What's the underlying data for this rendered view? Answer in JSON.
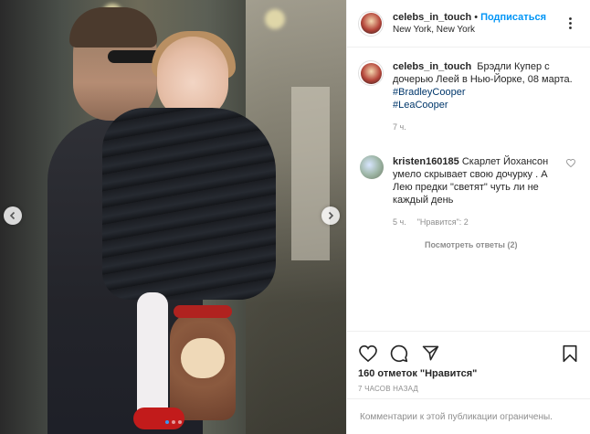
{
  "post": {
    "username": "celebs_in_touch",
    "separator": "•",
    "follow_label": "Подписаться",
    "location": "New York, New York"
  },
  "caption": {
    "username": "celebs_in_touch",
    "text": "Брэдли Купер с дочерью Леей в Нью-Йорке, 08 марта.",
    "hashtags": [
      "#BradleyCooper",
      "#LeaCooper"
    ],
    "time": "7 ч."
  },
  "comment": {
    "username": "kristen160185",
    "text": "Скарлет Йохансон умело скрывает свою дочурку . А Лею предки \"светят\" чуть ли не каждый день",
    "time": "5 ч.",
    "likes": "\"Нравится\": 2",
    "view_replies": "Посмотреть ответы (2)"
  },
  "actions": {
    "like_icon": "heart-icon",
    "comment_icon": "comment-icon",
    "share_icon": "share-icon",
    "save_icon": "bookmark-icon",
    "likes_count": "160 отметок \"Нравится\"",
    "posted_ago": "7 ЧАСОВ НАЗАД"
  },
  "footer": {
    "comments_limited": "Комментарии к этой публикации ограничены."
  },
  "carousel": {
    "dots": 3,
    "active_dot": 1,
    "accent": "#3897f0"
  },
  "colors": {
    "link": "#0095f6",
    "hashtag": "#00376b",
    "muted": "#8e8e8e"
  }
}
